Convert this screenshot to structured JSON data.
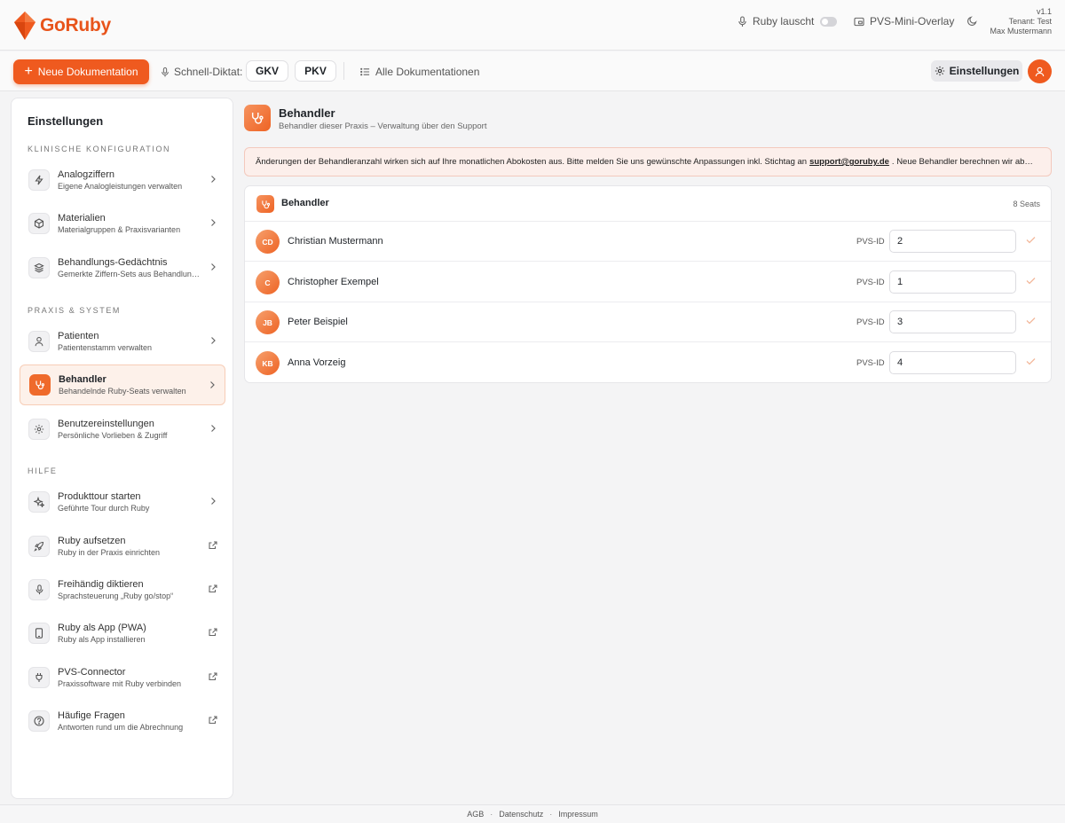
{
  "topbar": {
    "logo_text": "GoRuby",
    "listening_label": "Ruby lauscht",
    "overlay_label": "PVS-Mini-Overlay",
    "version": "v1.1",
    "tenant": "Tenant: Test",
    "user": "Max Mustermann"
  },
  "toolbar": {
    "new_doc_label": "Neue Dokumentation",
    "dictate_label": "Schnell-Diktat:",
    "gkv_label": "GKV",
    "pkv_label": "PKV",
    "all_docs_label": "Alle Dokumentationen",
    "settings_label": "Einstellungen"
  },
  "sidebar": {
    "title": "Einstellungen",
    "sections": [
      {
        "heading": "KLINISCHE KONFIGURATION"
      },
      {
        "heading": "PRAXIS & SYSTEM"
      },
      {
        "heading": "HILFE"
      }
    ],
    "items": [
      {
        "label": "Analogziffern",
        "sub": "Eigene Analogleistungen verwalten",
        "icon": "lightning-icon"
      },
      {
        "label": "Materialien",
        "sub": "Materialgruppen & Praxisvarianten",
        "icon": "box-icon"
      },
      {
        "label": "Behandlungs-Gedächtnis",
        "sub": "Gemerkte Ziffern-Sets aus Behandlungen",
        "icon": "layers-icon"
      },
      {
        "label": "Patienten",
        "sub": "Patientenstamm verwalten",
        "icon": "user-icon"
      },
      {
        "label": "Behandler",
        "sub": "Behandelnde Ruby-Seats verwalten",
        "icon": "stethoscope-icon"
      },
      {
        "label": "Benutzereinstellungen",
        "sub": "Persönliche Vorlieben & Zugriff",
        "icon": "gear-icon"
      },
      {
        "label": "Produkttour starten",
        "sub": "Geführte Tour durch Ruby",
        "icon": "sparkle-icon"
      },
      {
        "label": "Ruby aufsetzen",
        "sub": "Ruby in der Praxis einrichten",
        "icon": "rocket-icon"
      },
      {
        "label": "Freihändig diktieren",
        "sub": "Sprachsteuerung „Ruby go/stop“",
        "icon": "microphone-icon"
      },
      {
        "label": "Ruby als App (PWA)",
        "sub": "Ruby als App installieren",
        "icon": "phone-icon"
      },
      {
        "label": "PVS-Connector",
        "sub": "Praxissoftware mit Ruby verbinden",
        "icon": "plug-icon"
      },
      {
        "label": "Häufige Fragen",
        "sub": "Antworten rund um die Abrechnung",
        "icon": "help-icon"
      }
    ]
  },
  "main": {
    "title": "Behandler",
    "subtitle": "Behandler dieser Praxis – Verwaltung über den Support",
    "notice_pre": "Änderungen der Behandleranzahl wirken sich auf Ihre monatlichen Abokosten aus. Bitte melden Sie uns gewünschte Anpassungen inkl. Stichtag an",
    "notice_mail": "support@goruby.de",
    "notice_post": ". Neue Behandler berechnen wir ab…",
    "card_title": "Behandler",
    "seats": "8 Seats",
    "pvs_label": "PVS-ID",
    "practitioners": [
      {
        "initials": "CD",
        "name": "Christian Mustermann",
        "pvs_id": "2"
      },
      {
        "initials": "C",
        "name": "Christopher Exempel",
        "pvs_id": "1"
      },
      {
        "initials": "JB",
        "name": "Peter Beispiel",
        "pvs_id": "3"
      },
      {
        "initials": "KB",
        "name": "Anna Vorzeig",
        "pvs_id": "4"
      }
    ]
  },
  "footer": {
    "agb": "AGB",
    "datenschutz": "Datenschutz",
    "impressum": "Impressum"
  },
  "colors": {
    "accent": "#ef5a1f",
    "notice_bg": "#fcefeb"
  }
}
